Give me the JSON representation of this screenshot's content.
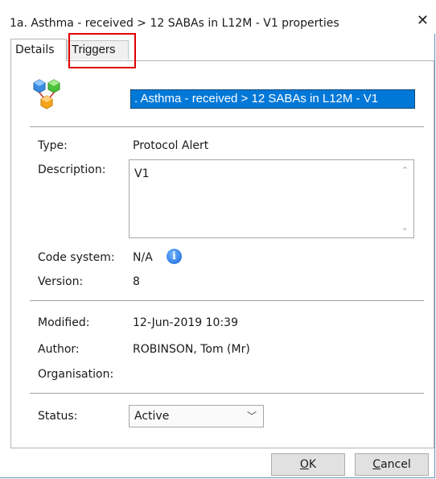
{
  "window": {
    "title": "1a. Asthma - received > 12 SABAs in L12M - V1 properties",
    "close_icon": "close-icon"
  },
  "tabs": [
    {
      "label": "Details",
      "selected": true
    },
    {
      "label": "Triggers",
      "selected": false,
      "highlighted": true
    }
  ],
  "details": {
    "logo_icon": "protocol-alert-icon",
    "name_value": ". Asthma - received > 12 SABAs in L12M - V1",
    "type": {
      "label": "Type:",
      "value": "Protocol Alert"
    },
    "description": {
      "label": "Description:",
      "value": "V1"
    },
    "code_system": {
      "label": "Code system:",
      "value": "N/A",
      "icon": "info-icon"
    },
    "version": {
      "label": "Version:",
      "value": "8"
    },
    "modified": {
      "label": "Modified:",
      "value": "12-Jun-2019 10:39"
    },
    "author": {
      "label": "Author:",
      "value": "ROBINSON, Tom (Mr)"
    },
    "organisation": {
      "label": "Organisation:",
      "value": ""
    },
    "status": {
      "label": "Status:",
      "value": "Active"
    }
  },
  "buttons": {
    "ok_prefix": "",
    "ok_access": "O",
    "ok_rest": "K",
    "cancel_prefix": "",
    "cancel_access": "C",
    "cancel_rest": "ancel"
  },
  "colors": {
    "selection": "#0078d7",
    "highlight_box": "#e00000",
    "info_icon": "#1565d8"
  }
}
